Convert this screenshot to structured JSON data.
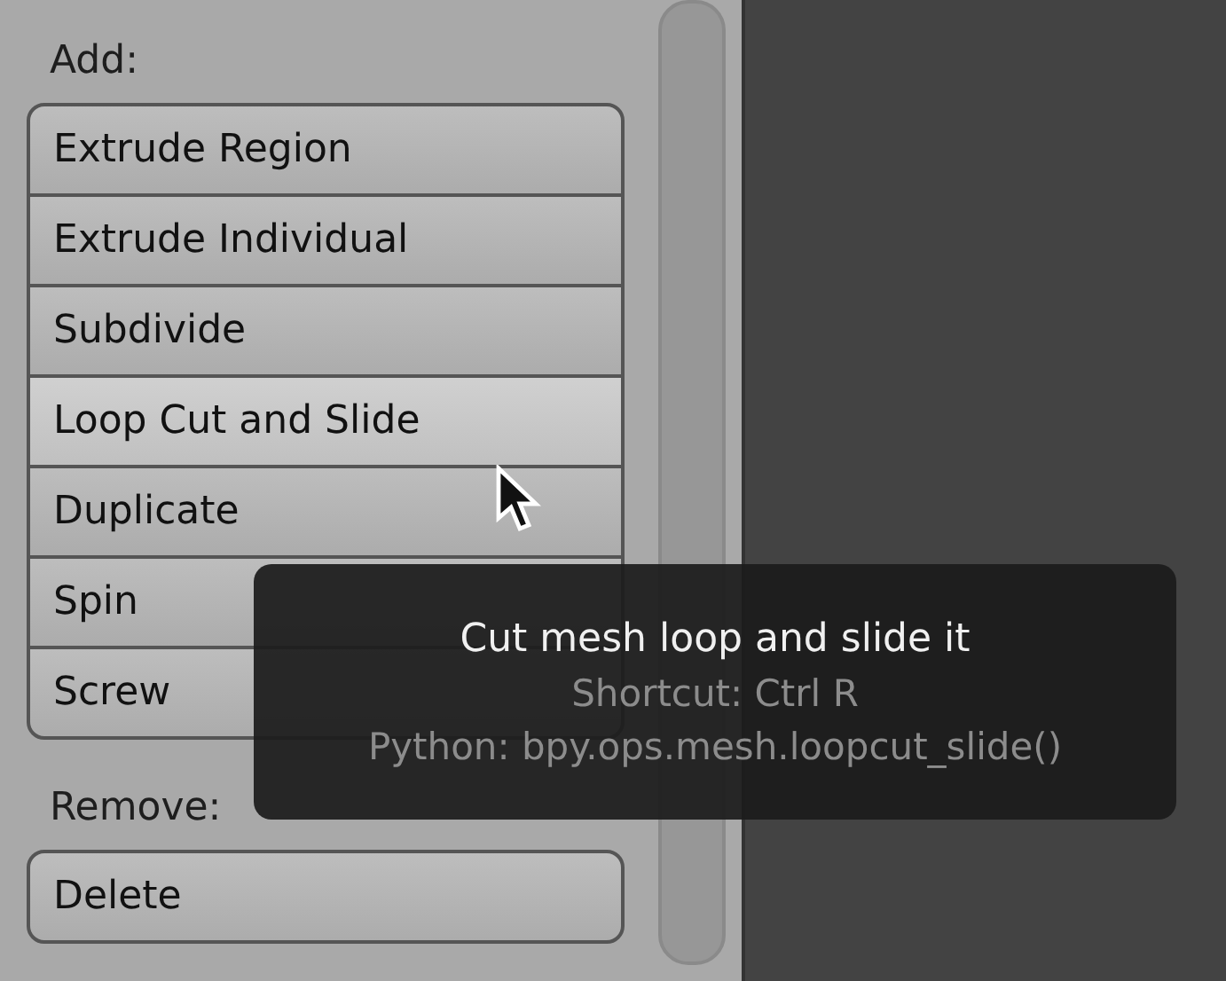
{
  "sections": [
    {
      "label": "Add:",
      "buttons": [
        {
          "label": "Extrude Region",
          "hovered": false
        },
        {
          "label": "Extrude Individual",
          "hovered": false
        },
        {
          "label": "Subdivide",
          "hovered": false
        },
        {
          "label": "Loop Cut and Slide",
          "hovered": true
        },
        {
          "label": "Duplicate",
          "hovered": false
        },
        {
          "label": "Spin",
          "hovered": false
        },
        {
          "label": "Screw",
          "hovered": false
        }
      ]
    },
    {
      "label": "Remove:",
      "buttons": [
        {
          "label": "Delete",
          "hovered": false
        }
      ]
    }
  ],
  "tooltip": {
    "title": "Cut mesh loop and slide it",
    "shortcut": "Shortcut: Ctrl R",
    "python": "Python: bpy.ops.mesh.loopcut_slide()"
  }
}
